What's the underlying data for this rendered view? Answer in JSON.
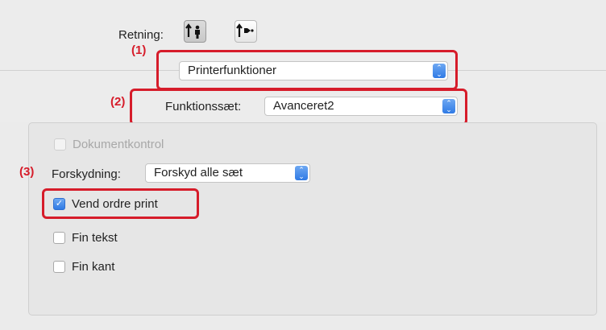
{
  "orientation": {
    "label": "Retning:",
    "options": [
      {
        "icon": "portrait-orientation-icon",
        "selected": true
      },
      {
        "icon": "landscape-orientation-icon",
        "selected": false
      }
    ]
  },
  "callouts": {
    "one": "(1)",
    "two": "(2)",
    "three": "(3)"
  },
  "panel_select": {
    "value": "Printerfunktioner"
  },
  "feature_set": {
    "label": "Funktionssæt:",
    "value": "Avanceret2"
  },
  "options": {
    "document_control": {
      "label": "Dokumentkontrol",
      "checked": false,
      "enabled": false
    },
    "offset": {
      "label": "Forskydning:",
      "value": "Forskyd alle sæt"
    },
    "reverse_order": {
      "label": "Vend ordre print",
      "checked": true,
      "enabled": true
    },
    "fine_text": {
      "label": "Fin tekst",
      "checked": false,
      "enabled": true
    },
    "fine_edge": {
      "label": "Fin kant",
      "checked": false,
      "enabled": true
    }
  },
  "colors": {
    "callout": "#d61c2a",
    "accent": "#2f7ae5"
  }
}
